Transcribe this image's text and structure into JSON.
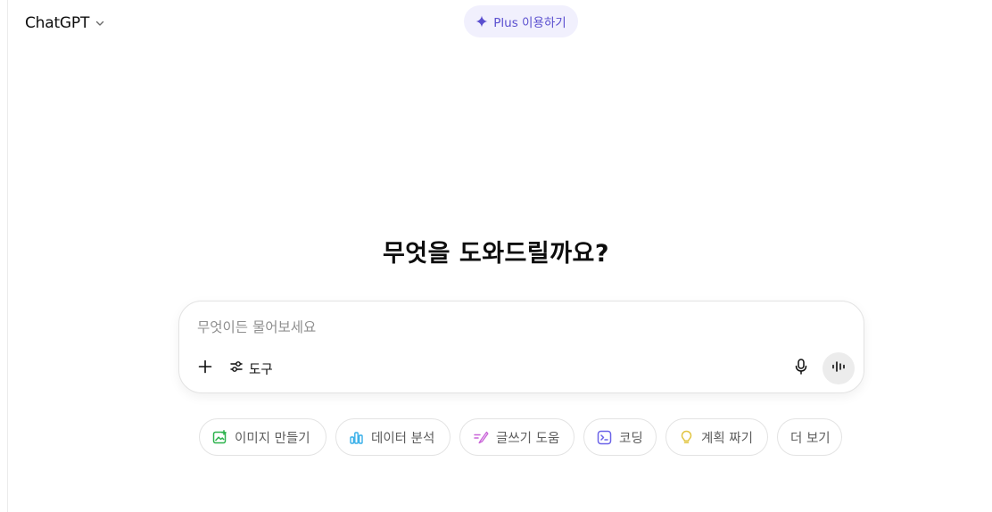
{
  "header": {
    "model_name": "ChatGPT",
    "plus_label": "Plus 이용하기"
  },
  "main": {
    "headline": "무엇을 도와드릴까요?"
  },
  "composer": {
    "placeholder": "무엇이든 물어보세요",
    "tools_label": "도구"
  },
  "suggestions": [
    {
      "label": "이미지 만들기",
      "icon": "image-create-icon",
      "color": "#2bb24c"
    },
    {
      "label": "데이터 분석",
      "icon": "bar-chart-icon",
      "color": "#35aee8"
    },
    {
      "label": "글쓰기 도움",
      "icon": "pen-icon",
      "color": "#c965d8"
    },
    {
      "label": "코딩",
      "icon": "code-terminal-icon",
      "color": "#6b63e8"
    },
    {
      "label": "계획 짜기",
      "icon": "lightbulb-icon",
      "color": "#e2c541"
    },
    {
      "label": "더 보기",
      "icon": "",
      "color": ""
    }
  ],
  "colors": {
    "accent": "#5a4fcf",
    "accent_bg": "#f1f0fd",
    "chip_border": "#e3e3e3"
  }
}
